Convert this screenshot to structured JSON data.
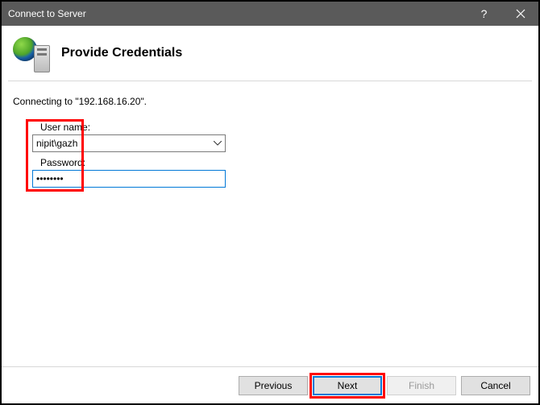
{
  "titlebar": {
    "title": "Connect to Server"
  },
  "header": {
    "heading": "Provide Credentials"
  },
  "content": {
    "status": "Connecting to \"192.168.16.20\".",
    "username_label": "User name:",
    "username_value": "nipit\\gazh",
    "password_label": "Password:",
    "password_value": "••••••••"
  },
  "footer": {
    "previous": "Previous",
    "next": "Next",
    "finish": "Finish",
    "cancel": "Cancel"
  }
}
